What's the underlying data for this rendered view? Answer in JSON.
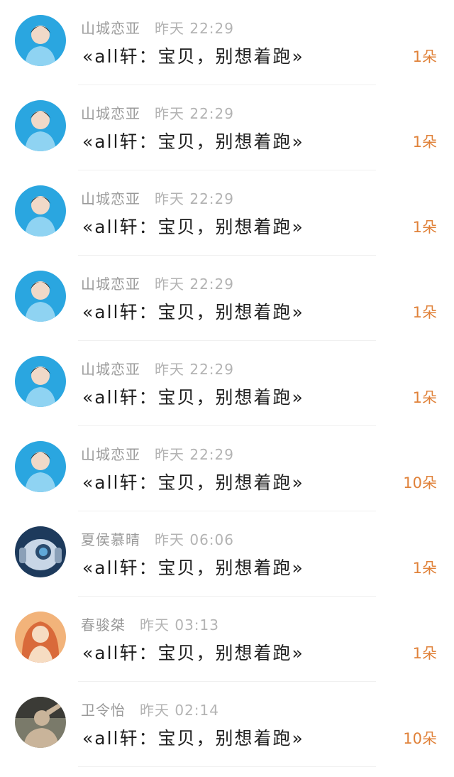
{
  "items": [
    {
      "name": "山城恋亚",
      "time": "昨天 22:29",
      "title": "«all轩：宝贝，别想着跑»",
      "gift": "1朵",
      "avatar_icon": "avatar-icon",
      "avatar_colors": [
        "#2aa6e0",
        "#8fd3f2",
        "#f0d9c8"
      ]
    },
    {
      "name": "山城恋亚",
      "time": "昨天 22:29",
      "title": "«all轩：宝贝，别想着跑»",
      "gift": "1朵",
      "avatar_icon": "avatar-icon",
      "avatar_colors": [
        "#2aa6e0",
        "#8fd3f2",
        "#f0d9c8"
      ]
    },
    {
      "name": "山城恋亚",
      "time": "昨天 22:29",
      "title": "«all轩：宝贝，别想着跑»",
      "gift": "1朵",
      "avatar_icon": "avatar-icon",
      "avatar_colors": [
        "#2aa6e0",
        "#8fd3f2",
        "#f0d9c8"
      ]
    },
    {
      "name": "山城恋亚",
      "time": "昨天 22:29",
      "title": "«all轩：宝贝，别想着跑»",
      "gift": "1朵",
      "avatar_icon": "avatar-icon",
      "avatar_colors": [
        "#2aa6e0",
        "#8fd3f2",
        "#f0d9c8"
      ]
    },
    {
      "name": "山城恋亚",
      "time": "昨天 22:29",
      "title": "«all轩：宝贝，别想着跑»",
      "gift": "1朵",
      "avatar_icon": "avatar-icon",
      "avatar_colors": [
        "#2aa6e0",
        "#8fd3f2",
        "#f0d9c8"
      ]
    },
    {
      "name": "山城恋亚",
      "time": "昨天 22:29",
      "title": "«all轩：宝贝，别想着跑»",
      "gift": "10朵",
      "avatar_icon": "avatar-icon",
      "avatar_colors": [
        "#2aa6e0",
        "#8fd3f2",
        "#f0d9c8"
      ]
    },
    {
      "name": "夏侯慕晴",
      "time": "昨天 06:06",
      "title": "«all轩：宝贝，别想着跑»",
      "gift": "1朵",
      "avatar_icon": "robot-avatar-icon",
      "avatar_colors": [
        "#1d3a5c",
        "#5fa8d8",
        "#c8d6e6"
      ]
    },
    {
      "name": "春骏桀",
      "time": "昨天 03:13",
      "title": "«all轩：宝贝，别想着跑»",
      "gift": "1朵",
      "avatar_icon": "avatar-icon",
      "avatar_colors": [
        "#f2b37a",
        "#d96a3a",
        "#f6dcc2"
      ]
    },
    {
      "name": "卫令怡",
      "time": "昨天 02:14",
      "title": "«all轩：宝贝，别想着跑»",
      "gift": "10朵",
      "avatar_icon": "avatar-icon",
      "avatar_colors": [
        "#7a7a6a",
        "#c9b49a",
        "#3b3b36"
      ]
    }
  ]
}
